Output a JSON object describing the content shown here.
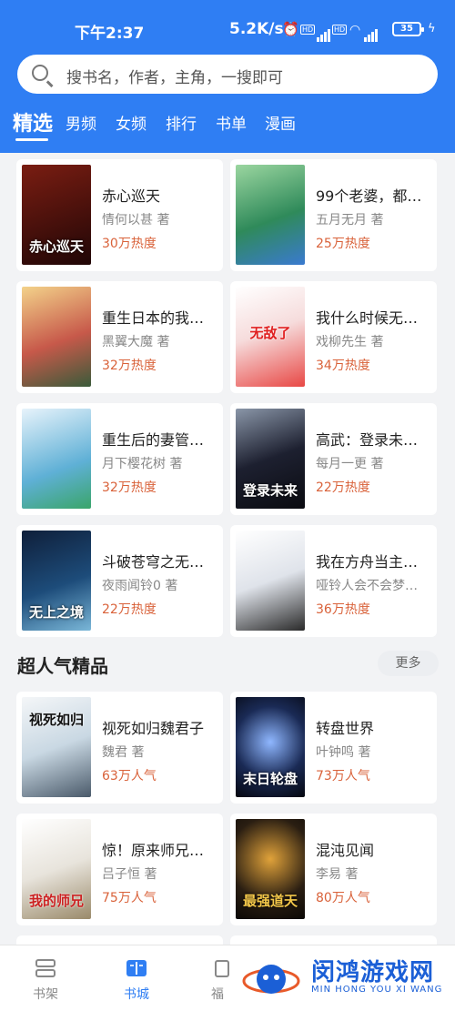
{
  "status_bar": {
    "time": "下午2:37",
    "network_speed": "5.2K/s",
    "battery": "35"
  },
  "search": {
    "placeholder": "搜书名，作者，主角，一搜即可"
  },
  "tabs": [
    {
      "label": "精选",
      "active": true
    },
    {
      "label": "男频"
    },
    {
      "label": "女频"
    },
    {
      "label": "排行"
    },
    {
      "label": "书单"
    },
    {
      "label": "漫画"
    }
  ],
  "featured_books": [
    {
      "title": "赤心巡天",
      "author": "情何以甚 著",
      "heat": "30万热度",
      "cover_text": "赤心巡天",
      "cover_color": "#3a0f0b"
    },
    {
      "title": "99个老婆，都…",
      "author": "五月无月 著",
      "heat": "25万热度",
      "cover_text": "",
      "cover_color": "#2f8a5a"
    },
    {
      "title": "重生日本的我…",
      "author": "黑翼大魔 著",
      "heat": "32万热度",
      "cover_text": "",
      "cover_color": "#c7594a"
    },
    {
      "title": "我什么时候无…",
      "author": "戏柳先生 著",
      "heat": "34万热度",
      "cover_text": "无敌了",
      "cover_color": "#e84845"
    },
    {
      "title": "重生后的妻管…",
      "author": "月下樱花树 著",
      "heat": "32万热度",
      "cover_text": "",
      "cover_color": "#5fb0d6"
    },
    {
      "title": "高武：登录未…",
      "author": "每月一更 著",
      "heat": "22万热度",
      "cover_text": "登录未来",
      "cover_color": "#1d2030"
    },
    {
      "title": "斗破苍穹之无…",
      "author": "夜雨闻铃0 著",
      "heat": "22万热度",
      "cover_text": "无上之境",
      "cover_color": "#1d4c7a"
    },
    {
      "title": "我在方舟当主…",
      "author": "哑铃人会不会梦…",
      "heat": "36万热度",
      "cover_text": "",
      "cover_color": "#dfe3ea"
    }
  ],
  "section": {
    "title": "超人气精品",
    "more_label": "更多"
  },
  "popular_books": [
    {
      "title": "视死如归魏君子",
      "author": "魏君 著",
      "heat": "63万人气",
      "cover_text": "视死如归",
      "cover_color": "#c9d8e3"
    },
    {
      "title": "转盘世界",
      "author": "叶钟鸣 著",
      "heat": "73万人气",
      "cover_text": "末日轮盘",
      "cover_color": "#1a2a55"
    },
    {
      "title": "惊！原来师兄…",
      "author": "吕子恒 著",
      "heat": "75万人气",
      "cover_text": "我的师兄",
      "cover_color": "#e8e4dc"
    },
    {
      "title": "混沌见闻",
      "author": "李易 著",
      "heat": "80万人气",
      "cover_text": "最强道天",
      "cover_color": "#2a1e12"
    }
  ],
  "bottom_nav": [
    {
      "label": "书架",
      "icon": "bookshelf-icon"
    },
    {
      "label": "书城",
      "icon": "bookstore-icon",
      "active": true
    },
    {
      "label": "福",
      "icon": "welfare-icon"
    }
  ],
  "watermark": {
    "text": "闵鸿游戏网",
    "sub": "MIN HONG YOU XI WANG"
  },
  "colors": {
    "primary": "#2f7ef3",
    "heat": "#d9623a"
  }
}
